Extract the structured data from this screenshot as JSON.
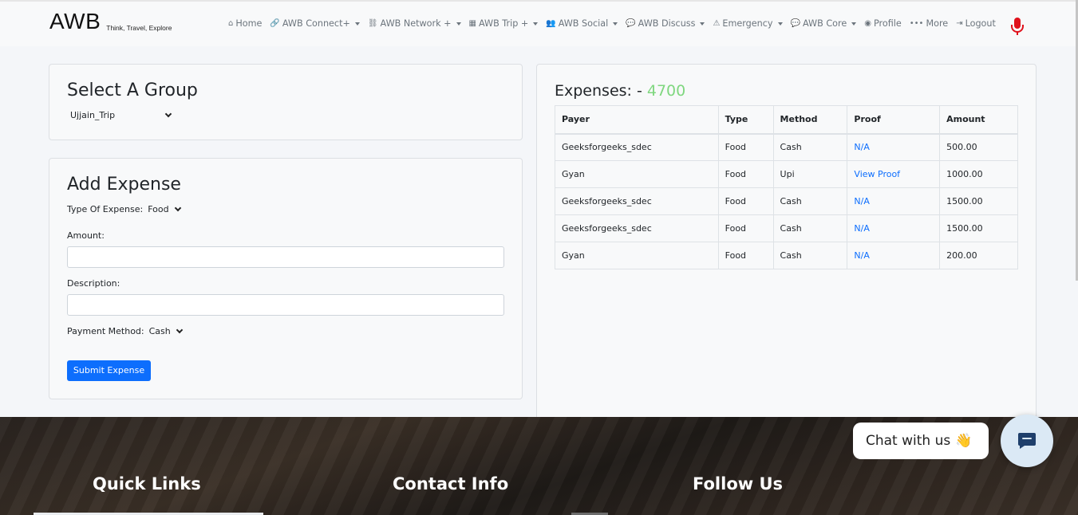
{
  "brand": {
    "name": "AWB",
    "tagline": "Think, Travel, Explore"
  },
  "nav": [
    {
      "label": "Home",
      "icon": "home-icon",
      "glyph": "⌂",
      "dropdown": false
    },
    {
      "label": "AWB Connect+",
      "icon": "link-icon",
      "glyph": "🔗",
      "dropdown": true
    },
    {
      "label": "AWB Network +",
      "icon": "network-icon",
      "glyph": "⛓",
      "dropdown": true
    },
    {
      "label": "AWB Trip +",
      "icon": "map-icon",
      "glyph": "▦",
      "dropdown": true
    },
    {
      "label": "AWB Social",
      "icon": "users-icon",
      "glyph": "👥",
      "dropdown": true
    },
    {
      "label": "AWB Discuss",
      "icon": "comments-icon",
      "glyph": "💬",
      "dropdown": true
    },
    {
      "label": "Emergency",
      "icon": "warning-icon",
      "glyph": "⚠",
      "dropdown": true
    },
    {
      "label": "AWB Core",
      "icon": "comments-icon",
      "glyph": "💬",
      "dropdown": true
    },
    {
      "label": "Profile",
      "icon": "user-circle-icon",
      "glyph": "◉",
      "dropdown": false
    },
    {
      "label": "More",
      "icon": "ellipsis-icon",
      "glyph": "•••",
      "dropdown": false
    },
    {
      "label": "Logout",
      "icon": "logout-icon",
      "glyph": "⇥",
      "dropdown": false
    }
  ],
  "select_group": {
    "title": "Select A Group",
    "selected": "Ujjain_Trip"
  },
  "add_expense": {
    "title": "Add Expense",
    "type_label": "Type Of Expense:",
    "type_value": "Food",
    "amount_label": "Amount:",
    "amount_value": "",
    "description_label": "Description:",
    "description_value": "",
    "method_label": "Payment Method:",
    "method_value": "Cash",
    "submit_label": "Submit Expense"
  },
  "expenses": {
    "title": "Expenses: -",
    "total": "4700",
    "columns": [
      "Payer",
      "Type",
      "Method",
      "Proof",
      "Amount"
    ],
    "rows": [
      {
        "payer": "Geeksforgeeks_sdec",
        "type": "Food",
        "method": "Cash",
        "proof": "N/A",
        "amount": "500.00"
      },
      {
        "payer": "Gyan",
        "type": "Food",
        "method": "Upi",
        "proof": "View Proof",
        "amount": "1000.00"
      },
      {
        "payer": "Geeksforgeeks_sdec",
        "type": "Food",
        "method": "Cash",
        "proof": "N/A",
        "amount": "1500.00"
      },
      {
        "payer": "Geeksforgeeks_sdec",
        "type": "Food",
        "method": "Cash",
        "proof": "N/A",
        "amount": "1500.00"
      },
      {
        "payer": "Gyan",
        "type": "Food",
        "method": "Cash",
        "proof": "N/A",
        "amount": "200.00"
      }
    ]
  },
  "footer": {
    "quick_links": "Quick Links",
    "contact_info": "Contact Info",
    "follow_us": "Follow Us"
  },
  "chat": {
    "label": "Chat with us",
    "emoji": "👋"
  },
  "colors": {
    "accent": "#0d6efd",
    "total": "#7fd77f",
    "mic": "#e0111b"
  }
}
